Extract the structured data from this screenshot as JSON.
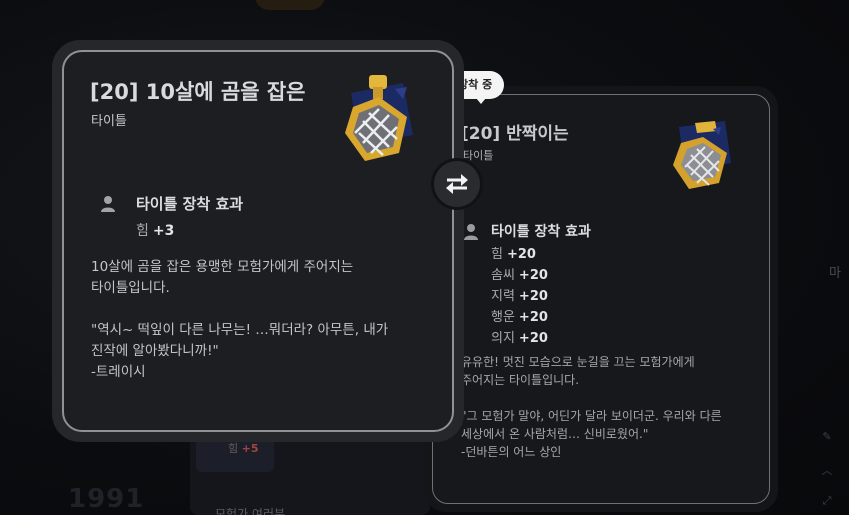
{
  "background": {
    "stat_label": "힘",
    "stat_value": "+5",
    "year": "1991",
    "bottom_text": "모험가 여러분",
    "right_text": "마"
  },
  "compare_card": {
    "title": "[20] 10살에 곰을 잡은",
    "type": "타이틀",
    "icon": "gold-knot-medal-icon",
    "effect_title": "타이틀 장착 효과",
    "stats": [
      {
        "label": "힘",
        "value": "+3"
      }
    ],
    "description": "10살에 곰을 잡은 용맹한 모험가에게 주어지는\n타이틀입니다.\n\n\"역시~ 떡잎이 다른 나무는! …뭐더라? 아무튼, 내가\n진작에 알아봤다니까!\"\n-트레이시"
  },
  "equipped_card": {
    "badge": "장착 중",
    "title": "[20] 반짝이는",
    "type": "타이틀",
    "icon": "silver-knot-medal-icon",
    "effect_title": "타이틀 장착 효과",
    "stats": [
      {
        "label": "힘",
        "value": "+20"
      },
      {
        "label": "솜씨",
        "value": "+20"
      },
      {
        "label": "지력",
        "value": "+20"
      },
      {
        "label": "행운",
        "value": "+20"
      },
      {
        "label": "의지",
        "value": "+20"
      }
    ],
    "description": "유유한! 멋진 모습으로 눈길을 끄는 모험가에게\n주어지는 타이틀입니다.\n\n\"그 모험가 말야, 어딘가 달라 보이더군. 우리와 다른\n세상에서 온 사람처럼… 신비로웠어.\"\n-던바튼의 어느 상인"
  },
  "swap_button": {
    "icon": "swap-arrows-icon"
  },
  "colors": {
    "card_bg": "#1d1e21",
    "border": "#8f9196",
    "badge_bg": "#f4f4f5"
  }
}
